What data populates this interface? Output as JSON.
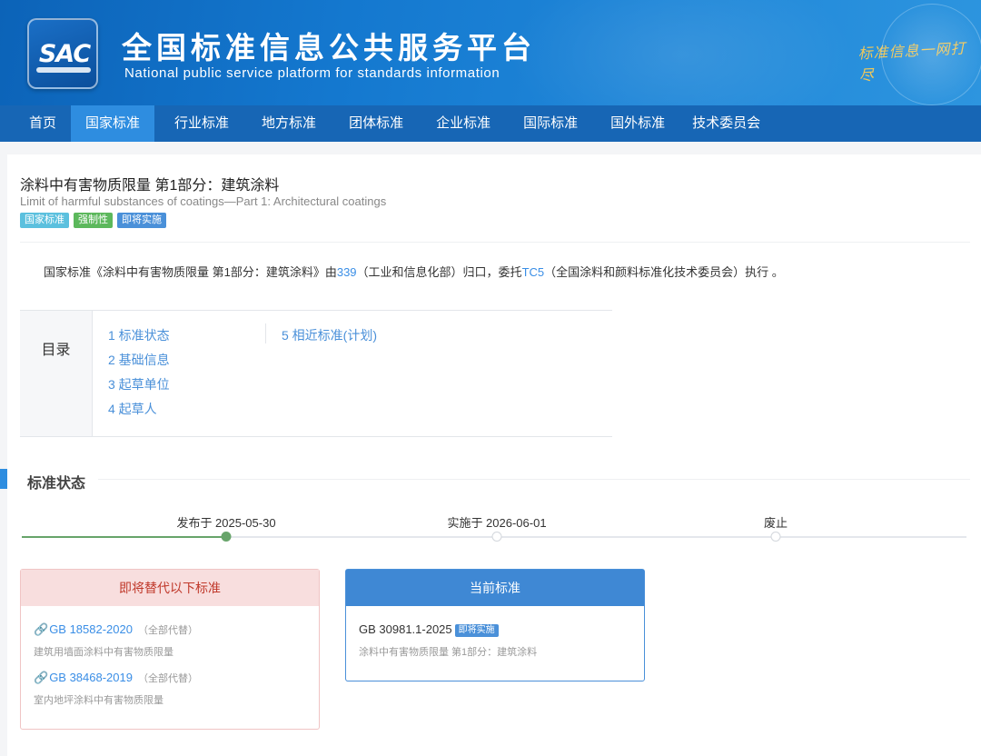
{
  "header": {
    "logo_text": "SAC",
    "title": "全国标准信息公共服务平台",
    "subtitle": "National public service platform  for standards information",
    "slogan": "标准信息一网打尽"
  },
  "nav": {
    "items": [
      {
        "label": "首页",
        "active": false
      },
      {
        "label": "国家标准",
        "active": true
      },
      {
        "label": "行业标准",
        "active": false
      },
      {
        "label": "地方标准",
        "active": false
      },
      {
        "label": "团体标准",
        "active": false
      },
      {
        "label": "企业标准",
        "active": false
      },
      {
        "label": "国际标准",
        "active": false
      },
      {
        "label": "国外标准",
        "active": false
      },
      {
        "label": "技术委员会",
        "active": false
      }
    ]
  },
  "standard": {
    "title_cn": "涂料中有害物质限量 第1部分：建筑涂料",
    "title_en": "Limit of harmful substances of coatings—Part 1: Architectural coatings",
    "tags": [
      {
        "label": "国家标准",
        "color": "#5bc0de"
      },
      {
        "label": "强制性",
        "color": "#5cb85c"
      },
      {
        "label": "即将实施",
        "color": "#4a90d9"
      }
    ],
    "desc": {
      "part1": "国家标准《涂料中有害物质限量 第1部分：建筑涂料》由",
      "org_code": "339",
      "part2": "（工业和信息化部）归口，委托",
      "tc_code": "TC5",
      "part3": "（全国涂料和颜料标准化技术委员会）执行 。"
    }
  },
  "toc": {
    "label": "目录",
    "items": [
      "1  标准状态",
      "2  基础信息",
      "3  起草单位",
      "4  起草人",
      "5  相近标准(计划)"
    ]
  },
  "status": {
    "title": "标准状态",
    "timeline": [
      {
        "label": "发布于 2025-05-30",
        "done": true
      },
      {
        "label": "实施于 2026-06-01",
        "done": false
      },
      {
        "label": "废止",
        "done": false
      }
    ],
    "colors": {
      "done": "#67a46a",
      "pending": "#d3d7dc"
    }
  },
  "replace": {
    "title": "即将替代以下标准",
    "items": [
      {
        "code": "GB 18582-2020",
        "note": "（全部代替）",
        "name": "建筑用墙面涂料中有害物质限量"
      },
      {
        "code": "GB 38468-2019",
        "note": "（全部代替）",
        "name": "室内地坪涂料中有害物质限量"
      }
    ]
  },
  "current": {
    "title": "当前标准",
    "code": "GB 30981.1-2025",
    "badge": "即将实施",
    "name": "涂料中有害物质限量 第1部分：建筑涂料"
  }
}
